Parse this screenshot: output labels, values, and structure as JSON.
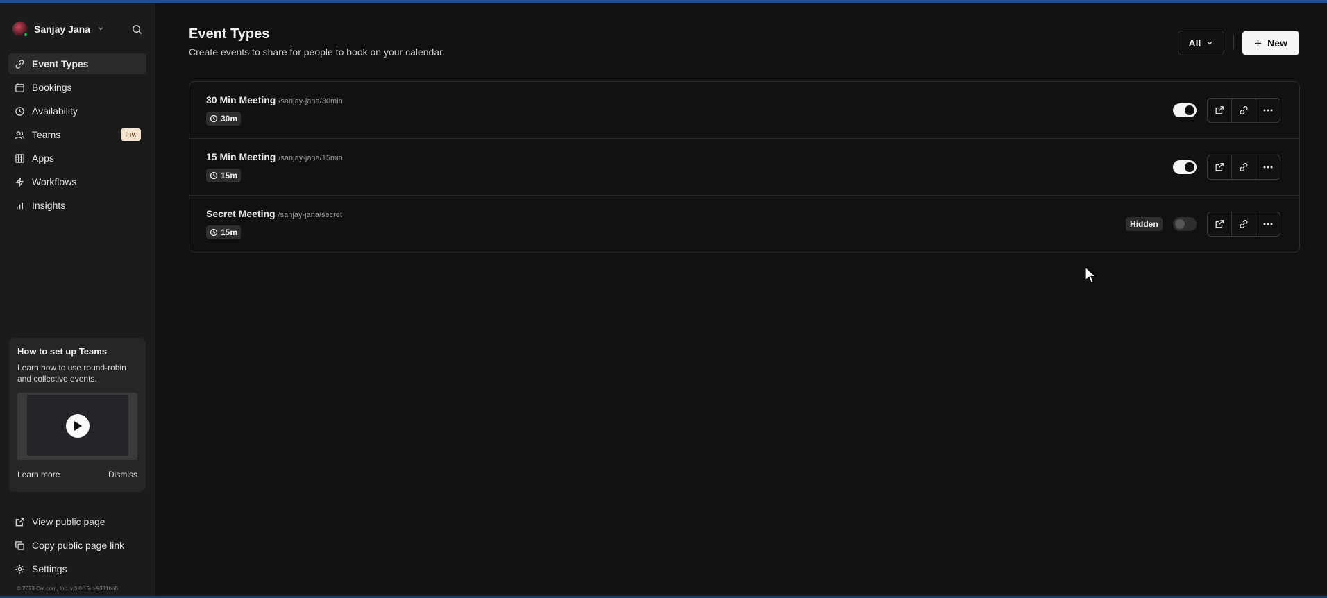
{
  "user": {
    "name": "Sanjay Jana"
  },
  "nav": {
    "items": [
      {
        "label": "Event Types",
        "icon": "link-icon",
        "active": true
      },
      {
        "label": "Bookings",
        "icon": "calendar-icon"
      },
      {
        "label": "Availability",
        "icon": "clock-icon"
      },
      {
        "label": "Teams",
        "icon": "users-icon",
        "badge": "Inv."
      },
      {
        "label": "Apps",
        "icon": "grid-icon"
      },
      {
        "label": "Workflows",
        "icon": "zap-icon"
      },
      {
        "label": "Insights",
        "icon": "bar-chart-icon"
      }
    ]
  },
  "promo": {
    "title": "How to set up Teams",
    "description": "Learn how to use round-robin and collective events.",
    "learn_more": "Learn more",
    "dismiss": "Dismiss"
  },
  "bottom_nav": {
    "items": [
      {
        "label": "View public page",
        "icon": "external-link-icon"
      },
      {
        "label": "Copy public page link",
        "icon": "copy-icon"
      },
      {
        "label": "Settings",
        "icon": "gear-icon"
      }
    ]
  },
  "copyright": "© 2023 Cal.com, Inc. v.3.0.15-h-9381bb5",
  "header": {
    "title": "Event Types",
    "subtitle": "Create events to share for people to book on your calendar.",
    "filter": "All",
    "new_button": "New"
  },
  "events": [
    {
      "title": "30 Min Meeting",
      "slug": "/sanjay-jana/30min",
      "duration": "30m",
      "enabled": true
    },
    {
      "title": "15 Min Meeting",
      "slug": "/sanjay-jana/15min",
      "duration": "15m",
      "enabled": true
    },
    {
      "title": "Secret Meeting",
      "slug": "/sanjay-jana/secret",
      "duration": "15m",
      "enabled": false,
      "badge": "Hidden"
    }
  ]
}
